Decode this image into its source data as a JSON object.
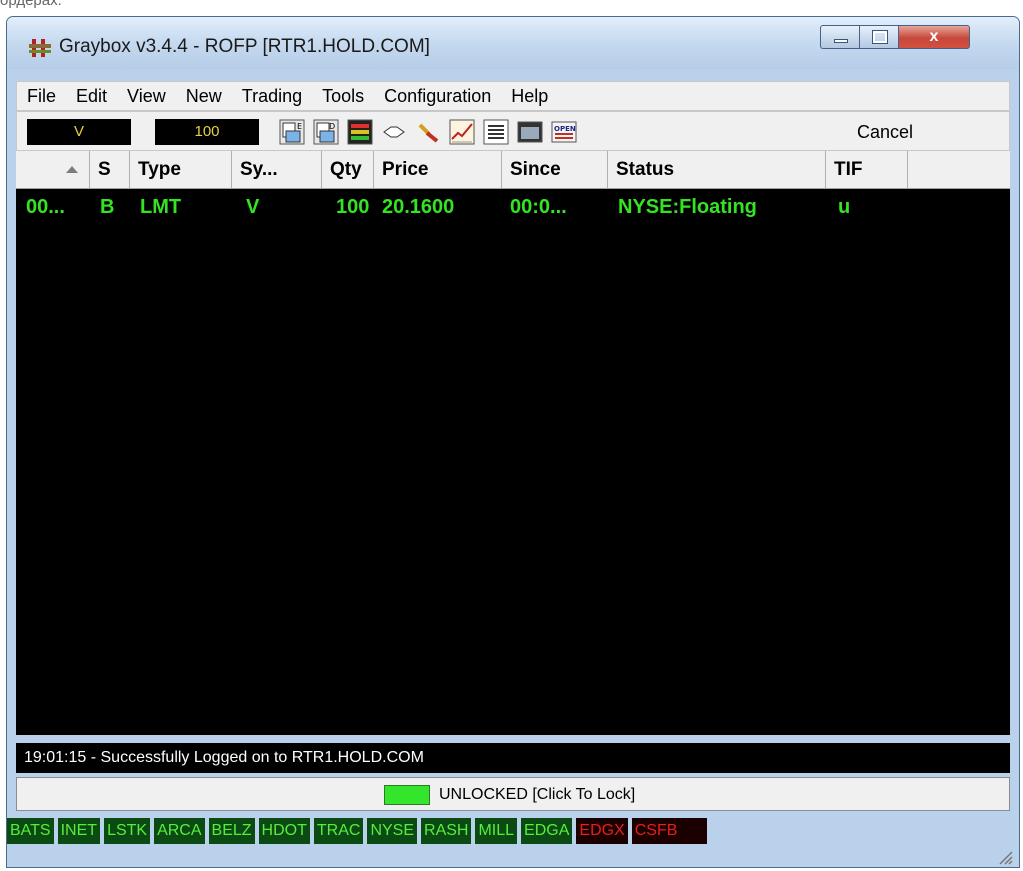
{
  "page_caption": "ордерах.",
  "window": {
    "title": "Graybox v3.4.4 - ROFP [RTR1.HOLD.COM]",
    "close_label": "x"
  },
  "menu": [
    "File",
    "Edit",
    "View",
    "New",
    "Trading",
    "Tools",
    "Configuration",
    "Help"
  ],
  "toolbar": {
    "symbol": "V",
    "quantity": "100",
    "cancel_label": "Cancel"
  },
  "orders": {
    "columns": [
      "S",
      "Type",
      "Sy...",
      "Qty",
      "Price",
      "Since",
      "Status",
      "TIF"
    ],
    "rows": [
      {
        "id": "00...",
        "side": "B",
        "type": "LMT",
        "symbol": "V",
        "qty": "100",
        "price": "20.1600",
        "since": "00:0...",
        "status": "NYSE:Floating",
        "tif": "u"
      }
    ]
  },
  "status_message": "19:01:15 - Successfully Logged on to RTR1.HOLD.COM",
  "lock_label": "UNLOCKED [Click To Lock]",
  "exchanges": [
    "BATS",
    "INET",
    "LSTK",
    "ARCA",
    "BELZ",
    "HDOT",
    "TRAC",
    "NYSE",
    "RASH",
    "MILL",
    "EDGA",
    "EDGX",
    "CSFB"
  ],
  "exchange_states": [
    "up",
    "up",
    "up",
    "up",
    "up",
    "up",
    "up",
    "up",
    "up",
    "up",
    "up",
    "down",
    "down"
  ]
}
